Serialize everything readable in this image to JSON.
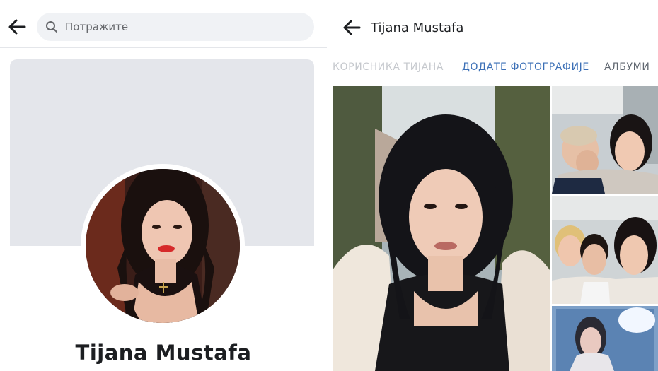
{
  "left_screen": {
    "search": {
      "placeholder": "Потражите",
      "icon": "search-icon"
    },
    "back_icon": "arrow-left-icon",
    "profile": {
      "name": "Tijana Mustafa"
    },
    "colors": {
      "cover": "#e4e6eb",
      "search_bg": "#f0f2f5"
    }
  },
  "right_screen": {
    "back_icon": "arrow-left-icon",
    "title": "Tijana Mustafa",
    "tabs": [
      {
        "label": "КОРИСНИКА ТИЈАНА"
      },
      {
        "label": "ДОДАТЕ ФОТОГРАФИЈЕ"
      },
      {
        "label": "АЛБУМИ"
      }
    ],
    "colors": {
      "active_tab": "#3b6fb6",
      "inactive_tab": "#606770"
    }
  }
}
